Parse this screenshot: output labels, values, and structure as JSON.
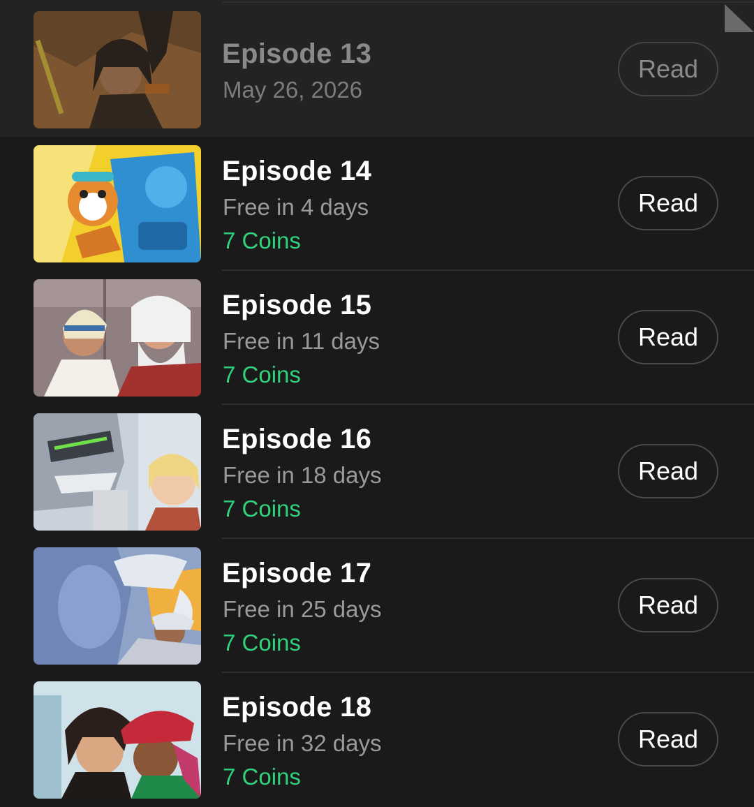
{
  "episodes": [
    {
      "title": "Episode 13",
      "subtitle": "May 26, 2026",
      "coins": "",
      "button": "Read",
      "read": true,
      "thumbnail": "episode-13-thumbnail"
    },
    {
      "title": "Episode 14",
      "subtitle": "Free in 4 days",
      "coins": "7 Coins",
      "button": "Read",
      "read": false,
      "thumbnail": "episode-14-thumbnail"
    },
    {
      "title": "Episode 15",
      "subtitle": "Free in 11 days",
      "coins": "7 Coins",
      "button": "Read",
      "read": false,
      "thumbnail": "episode-15-thumbnail"
    },
    {
      "title": "Episode 16",
      "subtitle": "Free in 18 days",
      "coins": "7 Coins",
      "button": "Read",
      "read": false,
      "thumbnail": "episode-16-thumbnail"
    },
    {
      "title": "Episode 17",
      "subtitle": "Free in 25 days",
      "coins": "7 Coins",
      "button": "Read",
      "read": false,
      "thumbnail": "episode-17-thumbnail"
    },
    {
      "title": "Episode 18",
      "subtitle": "Free in 32 days",
      "coins": "7 Coins",
      "button": "Read",
      "read": false,
      "thumbnail": "episode-18-thumbnail"
    }
  ],
  "colors": {
    "background": "#1a1a1a",
    "read_row_background": "#232323",
    "coins_green": "#2fd27a",
    "divider": "#2e2e2e"
  },
  "icons": {
    "corner": "corner-fold-icon"
  }
}
